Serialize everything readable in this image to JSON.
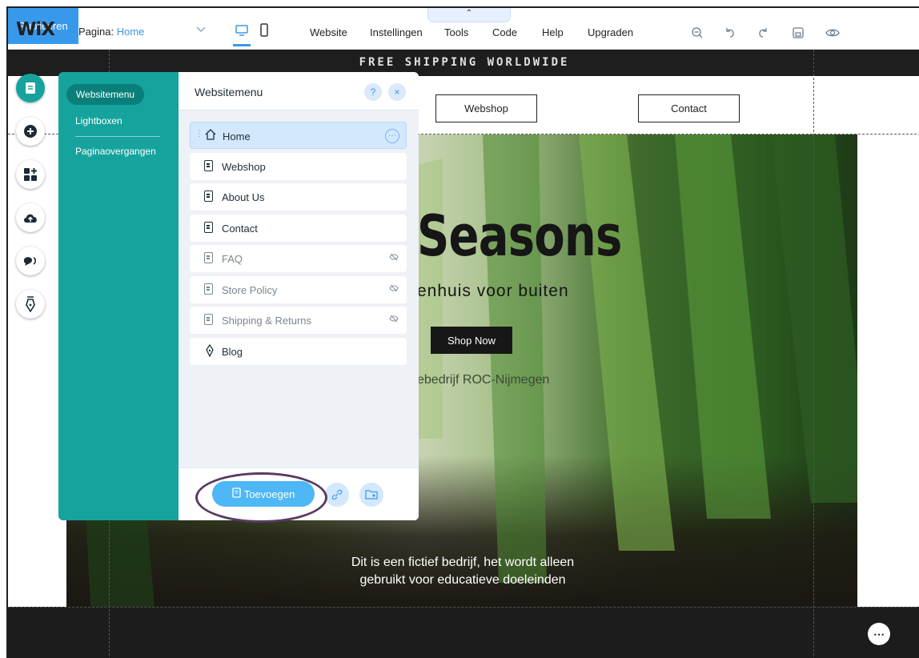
{
  "app": {
    "logo": "WiX"
  },
  "topbar": {
    "page_label": "Pagina:",
    "page_value": "Home",
    "menu": [
      "Website",
      "Instellingen",
      "Tools",
      "Code",
      "Help",
      "Upgraden"
    ],
    "publish_label": "Publiceren"
  },
  "site": {
    "banner": "FREE SHIPPING WORLDWIDE",
    "nav": [
      "Webshop",
      "Contact"
    ],
    "hero_title": "Seasons",
    "hero_subtitle": "enhuis voor buiten",
    "shop_button": "Shop Now",
    "hero_small": "ebedrijf ROC-Nijmegen",
    "hero_note_line1": "Dit is een fictief bedrijf, het wordt alleen",
    "hero_note_line2": "gebruikt voor educatieve doeleinden"
  },
  "side_panel": {
    "items": [
      "Websitemenu",
      "Lightboxen",
      "Paginaovergangen"
    ]
  },
  "pages_panel": {
    "title": "Websitemenu",
    "help": "?",
    "close": "×",
    "pages": [
      {
        "label": "Home",
        "hidden": false
      },
      {
        "label": "Webshop",
        "hidden": false
      },
      {
        "label": "About Us",
        "hidden": false
      },
      {
        "label": "Contact",
        "hidden": false
      },
      {
        "label": "FAQ",
        "hidden": true
      },
      {
        "label": "Store Policy",
        "hidden": true
      },
      {
        "label": "Shipping & Returns",
        "hidden": true
      },
      {
        "label": "Blog",
        "hidden": false
      }
    ],
    "add_button": "Toevoegen"
  },
  "colors": {
    "accent": "#3899ec",
    "panel_teal": "#16a39d",
    "highlight_ring": "#5b3a63"
  },
  "icons": {
    "toolbar": [
      "zoom-out-icon",
      "undo-icon",
      "redo-icon",
      "save-icon",
      "preview-eye-icon"
    ],
    "tools": [
      "pages-icon",
      "add-icon",
      "add-apps-icon",
      "upload-icon",
      "chat-icon",
      "pen-icon"
    ]
  }
}
